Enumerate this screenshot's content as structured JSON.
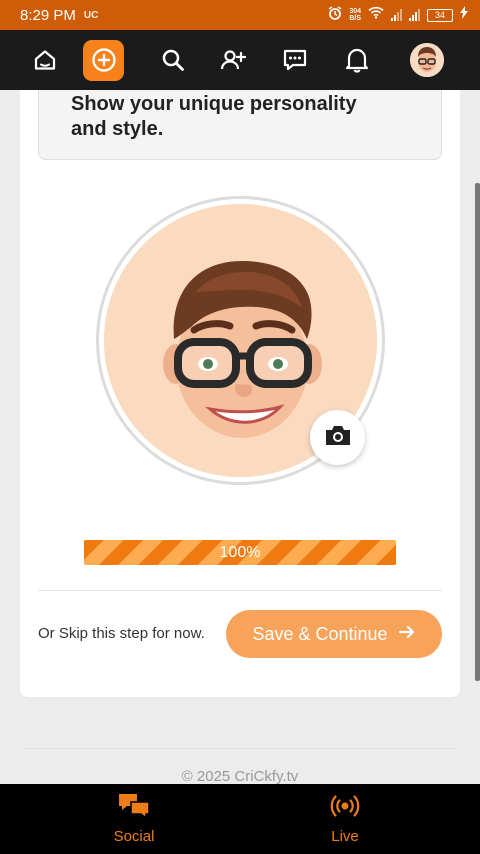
{
  "status_bar": {
    "time": "8:29 PM",
    "app_icon": "UC",
    "net_speed_value": "304",
    "net_speed_unit": "B/S",
    "battery": "34"
  },
  "top_nav": {
    "icons": [
      "home-icon",
      "create-post-icon",
      "search-icon",
      "add-friend-icon",
      "messages-icon",
      "notifications-icon",
      "profile-avatar"
    ],
    "accent_color": "#f7821b"
  },
  "intro": {
    "text_line1": "Show your unique personality",
    "text_line2": "and style."
  },
  "photo": {
    "avatar": "memoji-avatar",
    "camera": "camera-icon"
  },
  "progress": {
    "value_percent": 100,
    "label": "100%"
  },
  "actions": {
    "skip_text": "Or Skip this step for now.",
    "save_label": "Save & Continue"
  },
  "footer": {
    "copyright": "© 2025 CriCkfy.tv"
  },
  "bottom_nav": {
    "items": [
      {
        "label": "Social",
        "icon": "chat-bubbles-icon"
      },
      {
        "label": "Live",
        "icon": "live-broadcast-icon"
      }
    ]
  }
}
